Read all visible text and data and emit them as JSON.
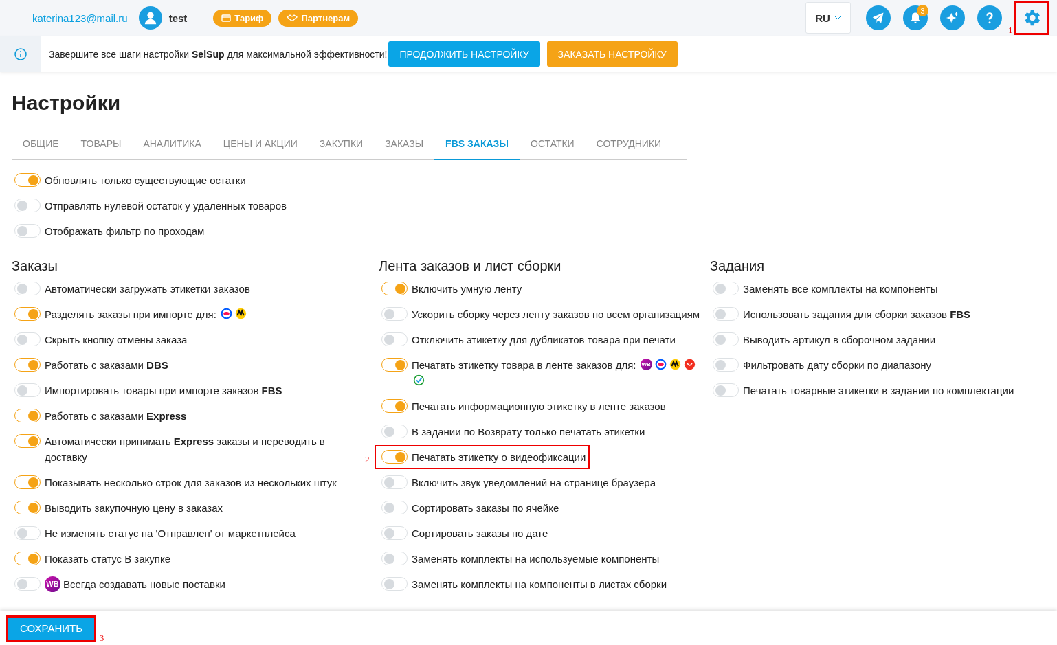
{
  "topbar": {
    "email": "katerina123@mail.ru",
    "user": "test",
    "pills": [
      {
        "kind": "card",
        "label": "Тариф"
      },
      {
        "kind": "handshake",
        "label": "Партнерам"
      }
    ],
    "language": "RU",
    "actions": [
      {
        "kind": "telegram"
      },
      {
        "kind": "bell",
        "badge": "3"
      },
      {
        "kind": "sparkle"
      },
      {
        "kind": "help"
      },
      {
        "kind": "gear",
        "annotation": "1"
      }
    ]
  },
  "banner": {
    "text": "Завершите все шаги настройки **SelSup** для максимальной эффективности!",
    "buttons": [
      {
        "kind": "primary",
        "label": "ПРОДОЛЖИТЬ НАСТРОЙКУ"
      },
      {
        "kind": "warning",
        "label": "ЗАКАЗАТЬ НАСТРОЙКУ"
      }
    ]
  },
  "title": "Настройки",
  "tabs": [
    {
      "label": "ОБЩИЕ",
      "selected": false
    },
    {
      "label": "ТОВАРЫ",
      "selected": false
    },
    {
      "label": "АНАЛИТИКА",
      "selected": false
    },
    {
      "label": "ЦЕНЫ И АКЦИИ",
      "selected": false
    },
    {
      "label": "ЗАКУПКИ",
      "selected": false
    },
    {
      "label": "ЗАКАЗЫ",
      "selected": false
    },
    {
      "label": "FBS ЗАКАЗЫ",
      "selected": true
    },
    {
      "label": "ОСТАТКИ",
      "selected": false
    },
    {
      "label": "СОТРУДНИКИ",
      "selected": false
    }
  ],
  "general": [
    {
      "label": "Обновлять только существующие остатки",
      "on": true
    },
    {
      "label": "Отправлять нулевой остаток у удаленных товаров",
      "on": false
    },
    {
      "label": "Отображать фильтр по проходам",
      "on": false
    }
  ],
  "sections": [
    {
      "title": "Заказы",
      "items": [
        {
          "label": "Автоматически загружать этикетки заказов",
          "on": false
        },
        {
          "label": "Разделять заказы при импорте  для:",
          "on": true,
          "markets": [
            {
              "kind": "ozon"
            },
            {
              "kind": "yandex"
            }
          ]
        },
        {
          "label": "Скрыть кнопку отмены заказа",
          "on": false
        },
        {
          "label": "Работать с заказами **DBS**",
          "on": true
        },
        {
          "label": "Импортировать товары при импорте заказов **FBS**",
          "on": false
        },
        {
          "label": "Работать с заказами **Express**",
          "on": true
        },
        {
          "label": "Автоматически принимать **Express** заказы и переводить в доставку",
          "on": true
        },
        {
          "label": "Показывать несколько строк для заказов из нескольких штук",
          "on": true
        },
        {
          "label": "Выводить закупочную цену в заказах",
          "on": true
        },
        {
          "label": "Не изменять статус на 'Отправлен' от маркетплейса",
          "on": false
        },
        {
          "label": "Показать статус В закупке",
          "on": true
        },
        {
          "label": "Всегда создавать новые поставки",
          "on": false,
          "prefix": {
            "kind": "wb",
            "text": "WB"
          }
        }
      ]
    },
    {
      "title": "Лента заказов и лист сборки",
      "items": [
        {
          "label": "Включить умную ленту",
          "on": true
        },
        {
          "label": "Ускорить сборку через ленту заказов по всем организациям",
          "on": false
        },
        {
          "label": "Отключить этикетку для дубликатов товара при печати",
          "on": false
        },
        {
          "label": "Печатать этикетку товара в ленте заказов  для:",
          "on": true,
          "markets": [
            {
              "kind": "wb",
              "text": "WB"
            },
            {
              "kind": "ozon"
            },
            {
              "kind": "yandex"
            },
            {
              "kind": "ali"
            },
            {
              "kind": "sber"
            }
          ]
        },
        {
          "label": "Печатать информационную этикетку в ленте заказов",
          "on": true
        },
        {
          "label": "В задании по Возврату только печатать этикетки",
          "on": false
        },
        {
          "label": "Печатать этикетку о видеофиксации",
          "on": true,
          "annotation": "2"
        },
        {
          "label": "Включить звук уведомлений на странице браузера",
          "on": false
        },
        {
          "label": "Сортировать заказы по ячейке",
          "on": false
        },
        {
          "label": "Сортировать заказы по дате",
          "on": false
        },
        {
          "label": "Заменять комплекты на используемые компоненты",
          "on": false
        },
        {
          "label": "Заменять комплекты на компоненты в листах сборки",
          "on": false
        }
      ]
    },
    {
      "title": "Задания",
      "items": [
        {
          "label": "Заменять все комплекты на компоненты",
          "on": false
        },
        {
          "label": "Использовать задания для сборки заказов **FBS**",
          "on": false
        },
        {
          "label": "Выводить артикул в сборочном задании",
          "on": false
        },
        {
          "label": "Фильтровать дату сборки по диапазону",
          "on": false
        },
        {
          "label": "Печатать товарные этикетки в задании по комплектации",
          "on": false
        }
      ]
    }
  ],
  "footer": {
    "save": "СОХРАНИТЬ",
    "annotation": "3"
  }
}
